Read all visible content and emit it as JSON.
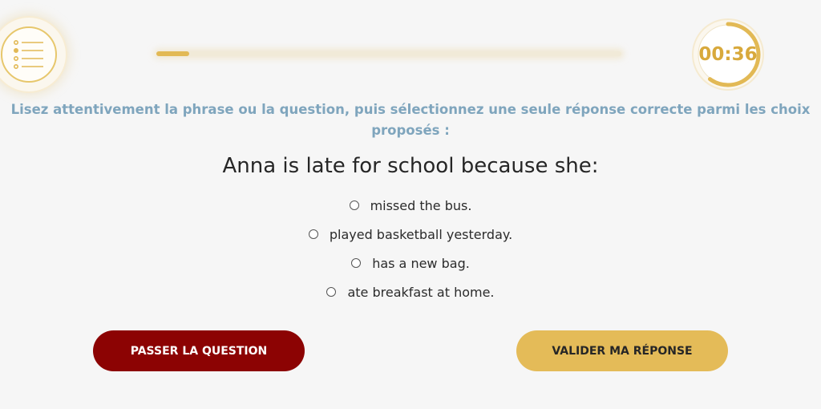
{
  "header": {
    "list_icon": "list-checklist-icon",
    "progress_fraction": 0.07,
    "timer": "00:36",
    "timer_fraction_remaining": 0.6
  },
  "instruction": "Lisez attentivement la phrase ou la question, puis sélectionnez une seule réponse correcte parmi les choix proposés :",
  "question": "Anna is late for school because she:",
  "answers": [
    {
      "label": "missed the bus."
    },
    {
      "label": "played basketball yesterday."
    },
    {
      "label": "has a new bag."
    },
    {
      "label": "ate breakfast at home."
    }
  ],
  "buttons": {
    "skip_label": "PASSER LA QUESTION",
    "validate_label": "VALIDER MA RÉPONSE"
  },
  "colors": {
    "accent_gold": "#e4bb58",
    "skip_red": "#8c0303",
    "instruction_blue": "#7fa5bd"
  }
}
